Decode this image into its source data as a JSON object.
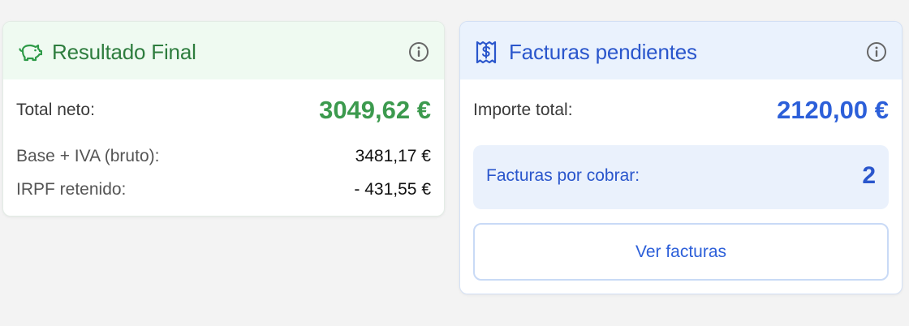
{
  "result_card": {
    "title": "Resultado Final",
    "icon": "piggy-bank-icon",
    "accent_color": "#2e7d3e",
    "total_label": "Total neto:",
    "total_value": "3049,62 €",
    "gross_label": "Base + IVA (bruto):",
    "gross_value": "3481,17 €",
    "irpf_label": "IRPF retenido:",
    "irpf_value": "- 431,55 €"
  },
  "invoices_card": {
    "title": "Facturas pendientes",
    "icon": "receipt-dollar-icon",
    "accent_color": "#2a56cc",
    "amount_label": "Importe total:",
    "amount_value": "2120,00 €",
    "pending_label": "Facturas por cobrar:",
    "pending_count": "2",
    "button_label": "Ver facturas"
  }
}
